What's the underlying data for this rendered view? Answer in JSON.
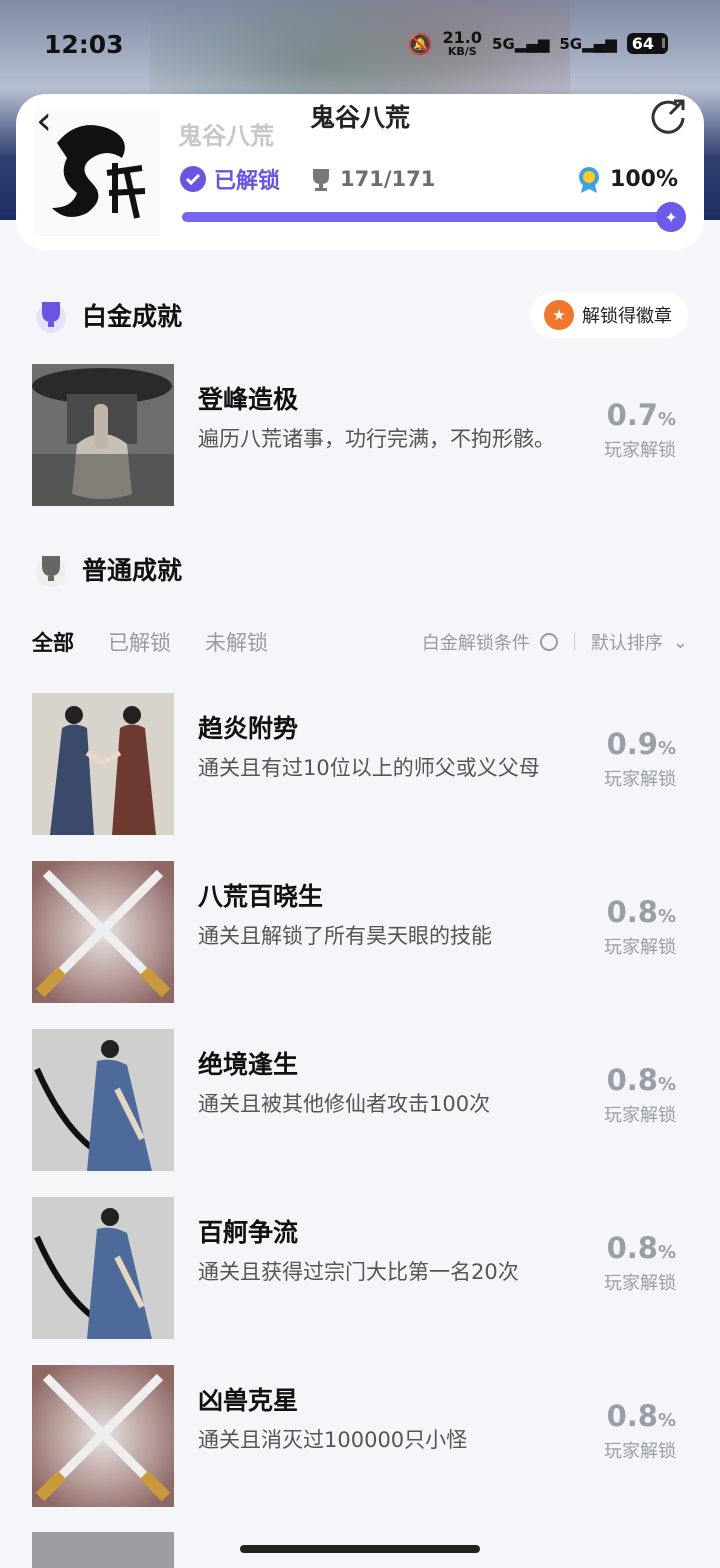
{
  "status_bar": {
    "time": "12:03",
    "net_speed_value": "21.0",
    "net_speed_unit": "KB/S",
    "signal_1": "5G",
    "signal_2": "5G",
    "battery": "64"
  },
  "header": {
    "faded_name": "鬼谷八荒",
    "title": "鬼谷八荒",
    "unlocked_label": "已解锁",
    "trophy_count": "171/171",
    "completion_percent": "100%",
    "progress": 1.0
  },
  "platinum_section": {
    "title": "白金成就",
    "badge_label": "解锁得徽章",
    "achievement": {
      "name": "登峰造极",
      "description": "遍历八荒诸事，功行完满，不拘形骸。",
      "rate": "0.7",
      "rate_unit": "%",
      "rate_label": "玩家解锁"
    }
  },
  "normal_section": {
    "title": "普通成就",
    "tabs": [
      "全部",
      "已解锁",
      "未解锁"
    ],
    "platinum_condition_label": "白金解锁条件",
    "sort_label": "默认排序",
    "achievements": [
      {
        "name": "趋炎附势",
        "description": "通关且有过10位以上的师父或义父母",
        "rate": "0.9",
        "rate_unit": "%",
        "rate_label": "玩家解锁",
        "icon": "two-figures-icon"
      },
      {
        "name": "八荒百晓生",
        "description": "通关且解锁了所有昊天眼的技能",
        "rate": "0.8",
        "rate_unit": "%",
        "rate_label": "玩家解锁",
        "icon": "crossed-swords-icon"
      },
      {
        "name": "绝境逢生",
        "description": "通关且被其他修仙者攻击100次",
        "rate": "0.8",
        "rate_unit": "%",
        "rate_label": "玩家解锁",
        "icon": "swordsman-icon"
      },
      {
        "name": "百舸争流",
        "description": "通关且获得过宗门大比第一名20次",
        "rate": "0.8",
        "rate_unit": "%",
        "rate_label": "玩家解锁",
        "icon": "swordsman-icon"
      },
      {
        "name": "凶兽克星",
        "description": "通关且消灭过100000只小怪",
        "rate": "0.8",
        "rate_unit": "%",
        "rate_label": "玩家解锁",
        "icon": "crossed-swords-icon"
      }
    ]
  },
  "colors": {
    "accent": "#6b54e0",
    "progress_fill": "#7466ee",
    "rate_gray": "#9a9fa7",
    "badge_orange": "#f0772b"
  }
}
